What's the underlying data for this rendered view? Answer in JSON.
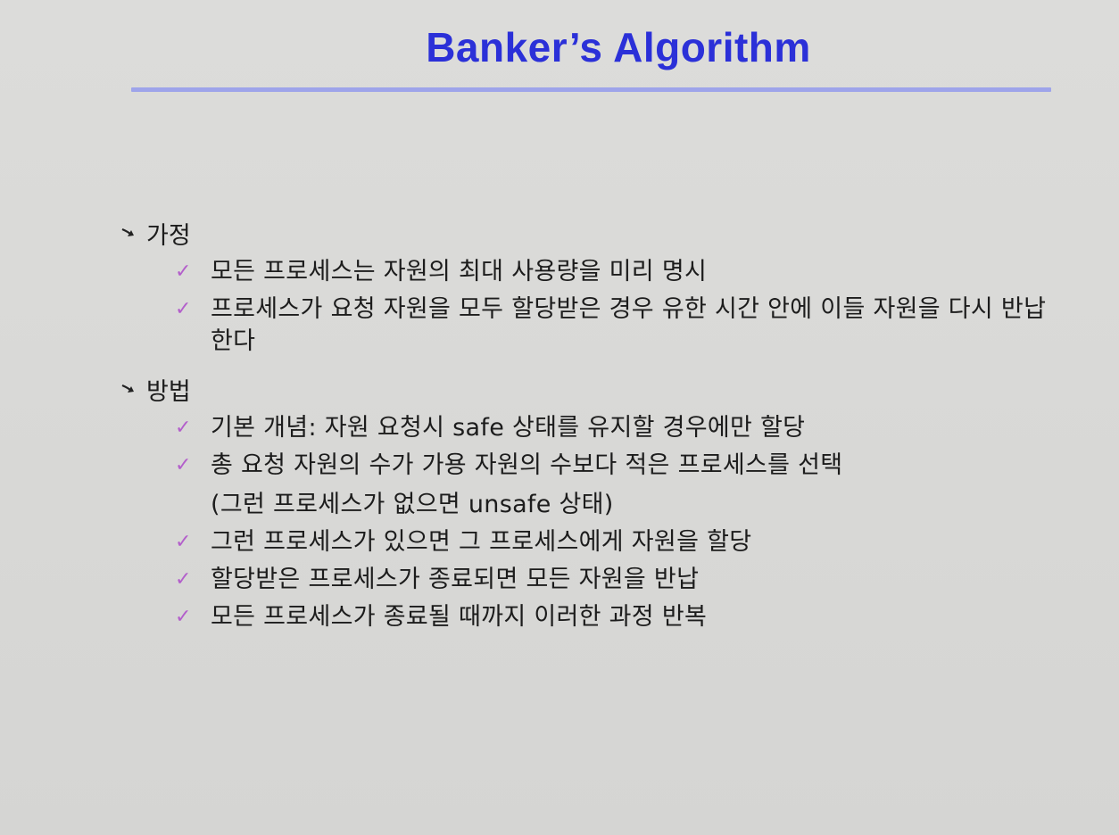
{
  "slide": {
    "title": "Banker’s Algorithm",
    "colors": {
      "title": "#2b30d8",
      "rule": "#9ea4ea",
      "check": "#b35fcb",
      "background": "#d9d9d7"
    },
    "sections": [
      {
        "heading": "가정",
        "bullet_icon": "arrow-bullet-icon",
        "items": [
          {
            "text": "모든 프로세스는 자원의 최대 사용량을 미리 명시"
          },
          {
            "text": "프로세스가 요청 자원을 모두 할당받은 경우 유한 시간 안에 이들 자원을 다시 반납한다"
          }
        ]
      },
      {
        "heading": "방법",
        "bullet_icon": "arrow-bullet-icon",
        "items": [
          {
            "text": "기본 개념: 자원 요청시 safe 상태를 유지할 경우에만 할당"
          },
          {
            "text": "총 요청 자원의 수가 가용 자원의 수보다 적은 프로세스를 선택",
            "continuation": "(그런 프로세스가 없으면 unsafe 상태)"
          },
          {
            "text": "그런 프로세스가 있으면 그 프로세스에게 자원을 할당"
          },
          {
            "text": "할당받은 프로세스가 종료되면 모든 자원을 반납"
          },
          {
            "text": "모든 프로세스가 종료될 때까지 이러한 과정 반복"
          }
        ]
      }
    ],
    "check_glyph": "✓"
  }
}
